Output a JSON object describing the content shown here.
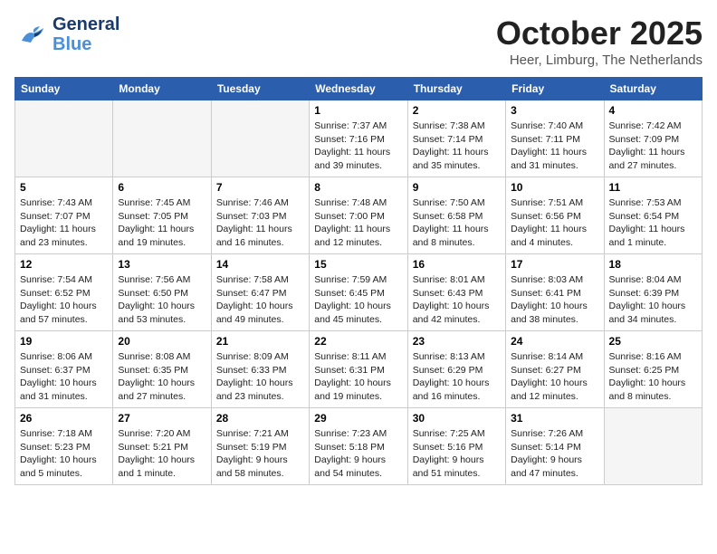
{
  "header": {
    "logo_line1": "General",
    "logo_line2": "Blue",
    "month_title": "October 2025",
    "location": "Heer, Limburg, The Netherlands"
  },
  "weekdays": [
    "Sunday",
    "Monday",
    "Tuesday",
    "Wednesday",
    "Thursday",
    "Friday",
    "Saturday"
  ],
  "weeks": [
    [
      {
        "day": "",
        "info": ""
      },
      {
        "day": "",
        "info": ""
      },
      {
        "day": "",
        "info": ""
      },
      {
        "day": "1",
        "info": "Sunrise: 7:37 AM\nSunset: 7:16 PM\nDaylight: 11 hours\nand 39 minutes."
      },
      {
        "day": "2",
        "info": "Sunrise: 7:38 AM\nSunset: 7:14 PM\nDaylight: 11 hours\nand 35 minutes."
      },
      {
        "day": "3",
        "info": "Sunrise: 7:40 AM\nSunset: 7:11 PM\nDaylight: 11 hours\nand 31 minutes."
      },
      {
        "day": "4",
        "info": "Sunrise: 7:42 AM\nSunset: 7:09 PM\nDaylight: 11 hours\nand 27 minutes."
      }
    ],
    [
      {
        "day": "5",
        "info": "Sunrise: 7:43 AM\nSunset: 7:07 PM\nDaylight: 11 hours\nand 23 minutes."
      },
      {
        "day": "6",
        "info": "Sunrise: 7:45 AM\nSunset: 7:05 PM\nDaylight: 11 hours\nand 19 minutes."
      },
      {
        "day": "7",
        "info": "Sunrise: 7:46 AM\nSunset: 7:03 PM\nDaylight: 11 hours\nand 16 minutes."
      },
      {
        "day": "8",
        "info": "Sunrise: 7:48 AM\nSunset: 7:00 PM\nDaylight: 11 hours\nand 12 minutes."
      },
      {
        "day": "9",
        "info": "Sunrise: 7:50 AM\nSunset: 6:58 PM\nDaylight: 11 hours\nand 8 minutes."
      },
      {
        "day": "10",
        "info": "Sunrise: 7:51 AM\nSunset: 6:56 PM\nDaylight: 11 hours\nand 4 minutes."
      },
      {
        "day": "11",
        "info": "Sunrise: 7:53 AM\nSunset: 6:54 PM\nDaylight: 11 hours\nand 1 minute."
      }
    ],
    [
      {
        "day": "12",
        "info": "Sunrise: 7:54 AM\nSunset: 6:52 PM\nDaylight: 10 hours\nand 57 minutes."
      },
      {
        "day": "13",
        "info": "Sunrise: 7:56 AM\nSunset: 6:50 PM\nDaylight: 10 hours\nand 53 minutes."
      },
      {
        "day": "14",
        "info": "Sunrise: 7:58 AM\nSunset: 6:47 PM\nDaylight: 10 hours\nand 49 minutes."
      },
      {
        "day": "15",
        "info": "Sunrise: 7:59 AM\nSunset: 6:45 PM\nDaylight: 10 hours\nand 45 minutes."
      },
      {
        "day": "16",
        "info": "Sunrise: 8:01 AM\nSunset: 6:43 PM\nDaylight: 10 hours\nand 42 minutes."
      },
      {
        "day": "17",
        "info": "Sunrise: 8:03 AM\nSunset: 6:41 PM\nDaylight: 10 hours\nand 38 minutes."
      },
      {
        "day": "18",
        "info": "Sunrise: 8:04 AM\nSunset: 6:39 PM\nDaylight: 10 hours\nand 34 minutes."
      }
    ],
    [
      {
        "day": "19",
        "info": "Sunrise: 8:06 AM\nSunset: 6:37 PM\nDaylight: 10 hours\nand 31 minutes."
      },
      {
        "day": "20",
        "info": "Sunrise: 8:08 AM\nSunset: 6:35 PM\nDaylight: 10 hours\nand 27 minutes."
      },
      {
        "day": "21",
        "info": "Sunrise: 8:09 AM\nSunset: 6:33 PM\nDaylight: 10 hours\nand 23 minutes."
      },
      {
        "day": "22",
        "info": "Sunrise: 8:11 AM\nSunset: 6:31 PM\nDaylight: 10 hours\nand 19 minutes."
      },
      {
        "day": "23",
        "info": "Sunrise: 8:13 AM\nSunset: 6:29 PM\nDaylight: 10 hours\nand 16 minutes."
      },
      {
        "day": "24",
        "info": "Sunrise: 8:14 AM\nSunset: 6:27 PM\nDaylight: 10 hours\nand 12 minutes."
      },
      {
        "day": "25",
        "info": "Sunrise: 8:16 AM\nSunset: 6:25 PM\nDaylight: 10 hours\nand 8 minutes."
      }
    ],
    [
      {
        "day": "26",
        "info": "Sunrise: 7:18 AM\nSunset: 5:23 PM\nDaylight: 10 hours\nand 5 minutes."
      },
      {
        "day": "27",
        "info": "Sunrise: 7:20 AM\nSunset: 5:21 PM\nDaylight: 10 hours\nand 1 minute."
      },
      {
        "day": "28",
        "info": "Sunrise: 7:21 AM\nSunset: 5:19 PM\nDaylight: 9 hours\nand 58 minutes."
      },
      {
        "day": "29",
        "info": "Sunrise: 7:23 AM\nSunset: 5:18 PM\nDaylight: 9 hours\nand 54 minutes."
      },
      {
        "day": "30",
        "info": "Sunrise: 7:25 AM\nSunset: 5:16 PM\nDaylight: 9 hours\nand 51 minutes."
      },
      {
        "day": "31",
        "info": "Sunrise: 7:26 AM\nSunset: 5:14 PM\nDaylight: 9 hours\nand 47 minutes."
      },
      {
        "day": "",
        "info": ""
      }
    ]
  ]
}
